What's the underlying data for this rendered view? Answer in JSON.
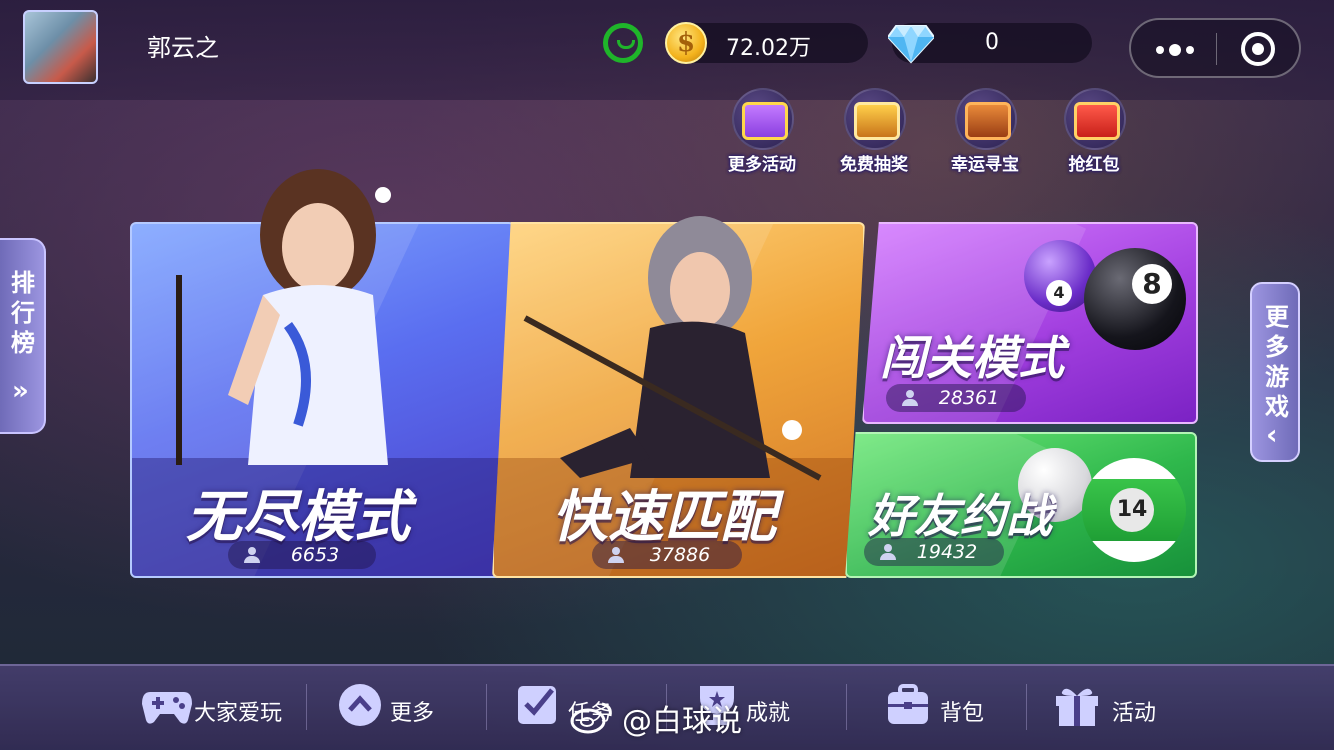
{
  "player": {
    "name": "郭云之"
  },
  "currency": {
    "coins": "72.02万",
    "diamonds": "0"
  },
  "activities": [
    {
      "label": "更多活动",
      "icon": "gift-box-icon"
    },
    {
      "label": "免费抽奖",
      "icon": "treasure-chest-icon"
    },
    {
      "label": "幸运寻宝",
      "icon": "treasure-tools-icon"
    },
    {
      "label": "抢红包",
      "icon": "red-envelope-icon"
    }
  ],
  "side_tabs": {
    "left": "排行榜",
    "right": "更多游戏"
  },
  "modes": {
    "endless": {
      "title": "无尽模式",
      "players": "6653"
    },
    "quick": {
      "title": "快速匹配",
      "players": "37886"
    },
    "level": {
      "title": "闯关模式",
      "players": "28361"
    },
    "friend": {
      "title": "好友约战",
      "players": "19432"
    }
  },
  "balls": {
    "small": "4",
    "large": "8",
    "green": "14"
  },
  "bottom_nav": [
    {
      "label": "大家爱玩",
      "icon": "gamepad-icon"
    },
    {
      "label": "更多",
      "icon": "chevron-up-icon"
    },
    {
      "label": "任务",
      "icon": "checkbox-icon"
    },
    {
      "label": "成就",
      "icon": "trophy-icon"
    },
    {
      "label": "背包",
      "icon": "backpack-icon"
    },
    {
      "label": "活动",
      "icon": "gift-icon"
    }
  ],
  "watermark": "@白球说",
  "colors": {
    "online_status": "#1fb52a",
    "endless_card": "#5a6ef0",
    "quick_card": "#f0a53b",
    "level_card": "#a340e0",
    "friend_card": "#2fb84c"
  }
}
